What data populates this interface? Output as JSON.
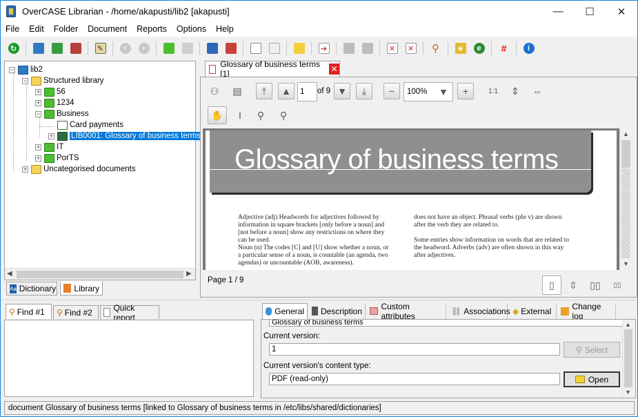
{
  "window": {
    "title": "OverCASE Librarian - /home/akapusti/lib2 [akapusti]",
    "minimize": "—",
    "maximize": "☐",
    "close": "✕"
  },
  "menu": [
    "File",
    "Edit",
    "Folder",
    "Document",
    "Reports",
    "Options",
    "Help"
  ],
  "tree": {
    "root": "lib2",
    "structured": "Structured library",
    "f56": "56",
    "f1234": "1234",
    "business": "Business",
    "card": "Card payments",
    "glossary": "LIB0001: Glossary of business terms",
    "it": "IT",
    "ports": "PorTS",
    "uncat": "Uncategorised documents"
  },
  "left_tabs": {
    "dictionary": "Dictionary",
    "library": "Library"
  },
  "doc_tab": {
    "label": "Glossary of business terms [1]"
  },
  "viewer": {
    "page_input": "1",
    "page_of": "of 9",
    "zoom": "100%",
    "page_status": "Page 1 / 9"
  },
  "pdf": {
    "title": "Glossary of business terms",
    "col1": [
      "Adjective (adj)  Headwords for adjectives followed by",
      "information in square brackets [only before a noun] and",
      "[not before a noun] show any restrictions on where they",
      "can be used.",
      "Noun (n)  The codes [C] and [U] show whether a noun, or",
      "a particular sense of a noun, is countable (an agenda, two",
      "agendas) or uncountable (AOB, awareness)."
    ],
    "col2": [
      "does not have an object. Phrasal verbs (phr v) are shown",
      "after the verb they are related to.",
      "",
      "Some entries show information on words that are related to",
      "the headword. Adverbs (adv) are often shown in this way",
      "after adjectives."
    ]
  },
  "find_tabs": {
    "find1": "Find #1",
    "find2": "Find #2",
    "quick": "Quick report"
  },
  "prop_tabs": {
    "general": "General",
    "description": "Description",
    "custom": "Custom attributes",
    "assoc": "Associations",
    "external": "External",
    "changelog": "Change log"
  },
  "props": {
    "name_value": "Glossary of business terms",
    "current_version_label": "Current version:",
    "current_version_value": "1",
    "select_button": "Select",
    "content_type_label": "Current version's content type:",
    "content_type_value": "PDF (read-only)",
    "open_button": "Open"
  },
  "status": "document Glossary of business terms [linked to Glossary of business terms in /etc/libs/shared/dictionaries]",
  "colors": {
    "accent": "#0078d7",
    "folder_green": "#4cbf2f",
    "folder_yellow": "#f3d35a"
  }
}
